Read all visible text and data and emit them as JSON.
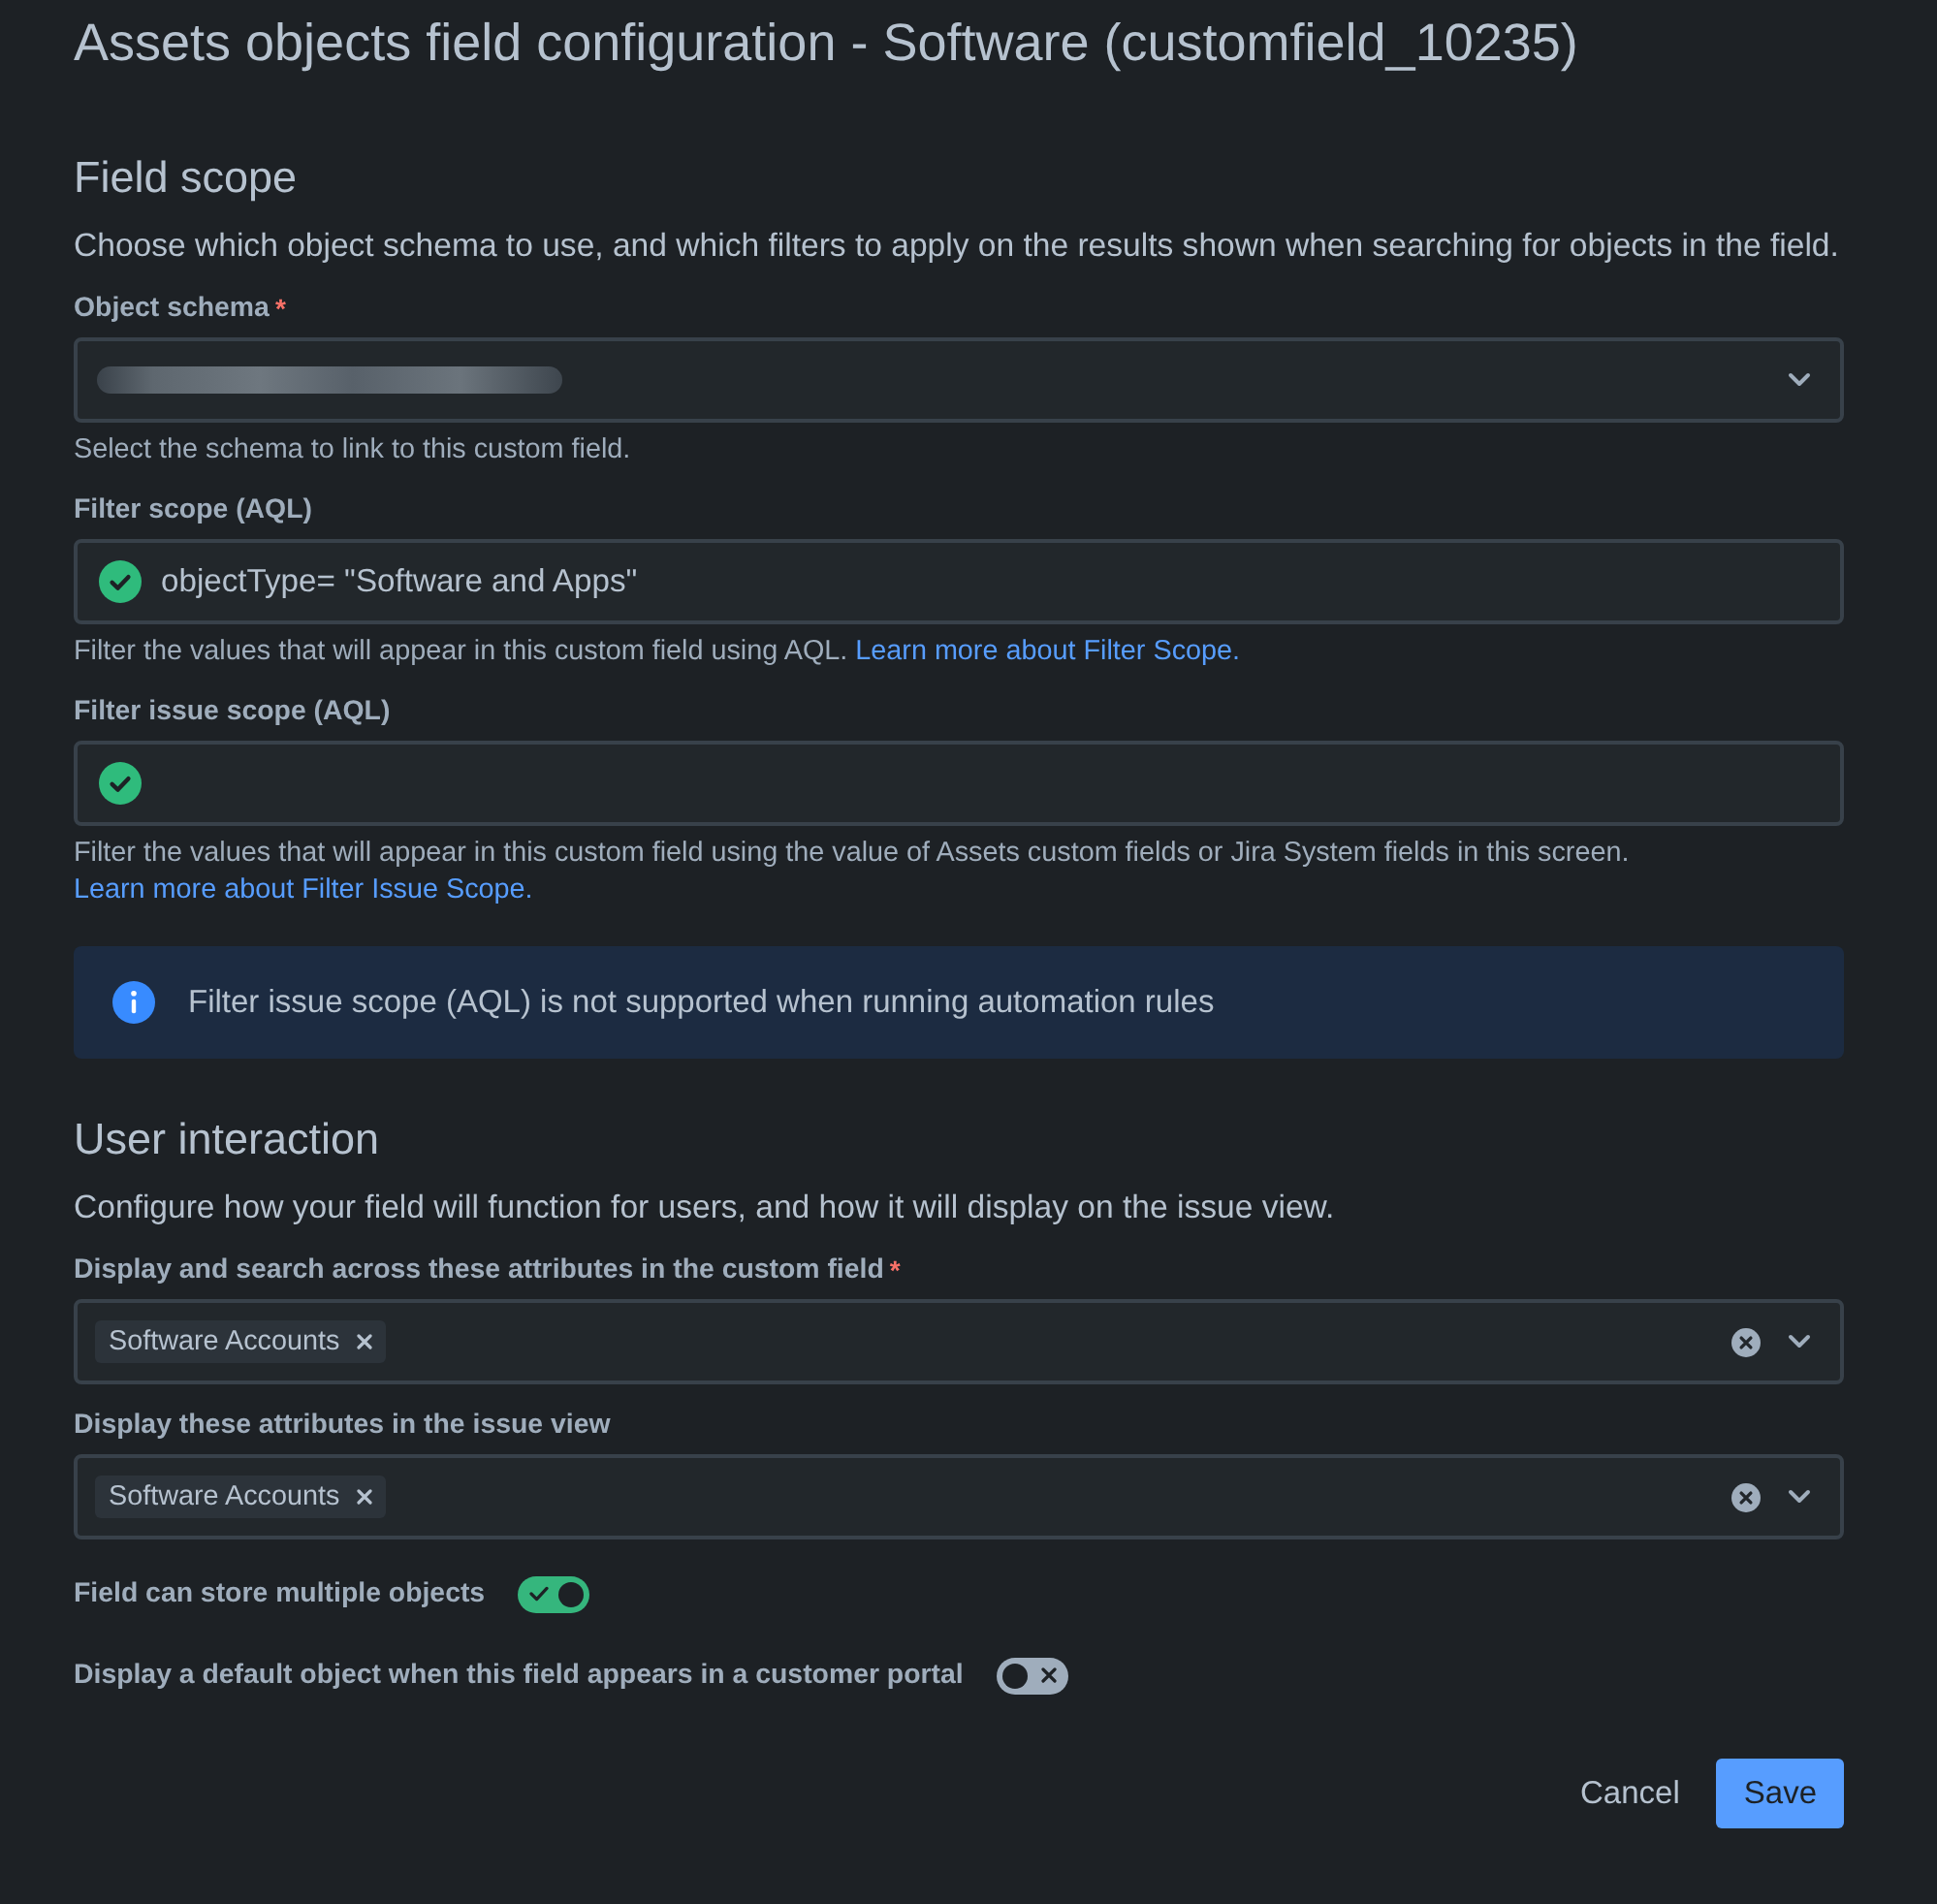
{
  "page": {
    "title": "Assets objects field configuration - Software (customfield_10235)"
  },
  "sections": [
    {
      "heading": "Field scope",
      "description": "Choose which object schema to use, and which filters to apply on the results shown when searching for objects in the field.",
      "items": [
        {
          "kind": "select",
          "label": "Object schema",
          "required_mark": "*",
          "value_redacted": true,
          "helper": {
            "text": "Select the schema to link to this custom field."
          }
        },
        {
          "kind": "aql",
          "label": "Filter scope (AQL)",
          "valid": true,
          "value": "objectType= \"Software and Apps\"",
          "helper": {
            "text": "Filter the values that will appear in this custom field using AQL.",
            "link": "Learn more about Filter Scope."
          }
        },
        {
          "kind": "aql",
          "label": "Filter issue scope (AQL)",
          "valid": true,
          "helper": {
            "text": "Filter the values that will appear in this custom field using the value of Assets custom fields or Jira System fields in this screen.",
            "link": "Learn more about Filter Issue Scope."
          }
        },
        {
          "kind": "notice",
          "text": "Filter issue scope (AQL) is not supported when running automation rules"
        }
      ]
    },
    {
      "heading": "User interaction",
      "description": "Configure how your field will function for users, and how it will display on the issue view.",
      "items": [
        {
          "kind": "multiselect",
          "label": "Display and search across these attributes in the custom field",
          "required_mark": "*",
          "tags": [
            {
              "label": "Software Accounts"
            }
          ]
        },
        {
          "kind": "multiselect",
          "label": "Display these attributes in the issue view",
          "tags": [
            {
              "label": "Software Accounts"
            }
          ]
        },
        {
          "kind": "toggle",
          "label": "Field can store multiple objects",
          "on": true
        },
        {
          "kind": "toggle",
          "label": "Display a default object when this field appears in a customer portal",
          "on": false
        }
      ]
    }
  ],
  "buttons": [
    {
      "label": "Cancel",
      "kind": "subtle"
    },
    {
      "label": "Save",
      "kind": "primary"
    }
  ]
}
